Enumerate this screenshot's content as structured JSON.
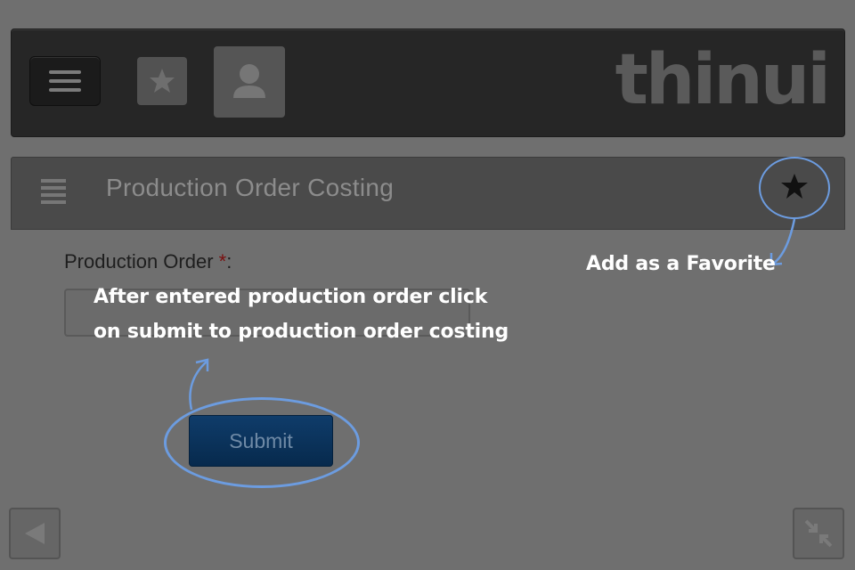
{
  "app": {
    "logo_text": "thinui"
  },
  "header": {
    "title": "Production Order Costing"
  },
  "form": {
    "field_label": "Production Order",
    "required_marker": "*",
    "label_suffix": ":",
    "input_value": "",
    "submit_label": "Submit"
  },
  "annotations": {
    "favorite_hint": "Add as a Favorite",
    "submit_hint_line1": "After entered production order click",
    "submit_hint_line2": "on submit to production order costing"
  },
  "icons": {
    "menu": "hamburger-icon",
    "favorite": "star-icon",
    "user": "user-icon",
    "list": "list-icon",
    "back": "back-arrow-icon",
    "collapse": "collapse-icon"
  },
  "colors": {
    "overlay_background": "#6f6f6f",
    "topbar": "#262626",
    "header": "#4a4a4a",
    "submit_button": "#0f3c6a",
    "highlight_ring": "#6c9ce0",
    "required_marker": "#7a0f0f",
    "hint_text": "#ffffff"
  }
}
